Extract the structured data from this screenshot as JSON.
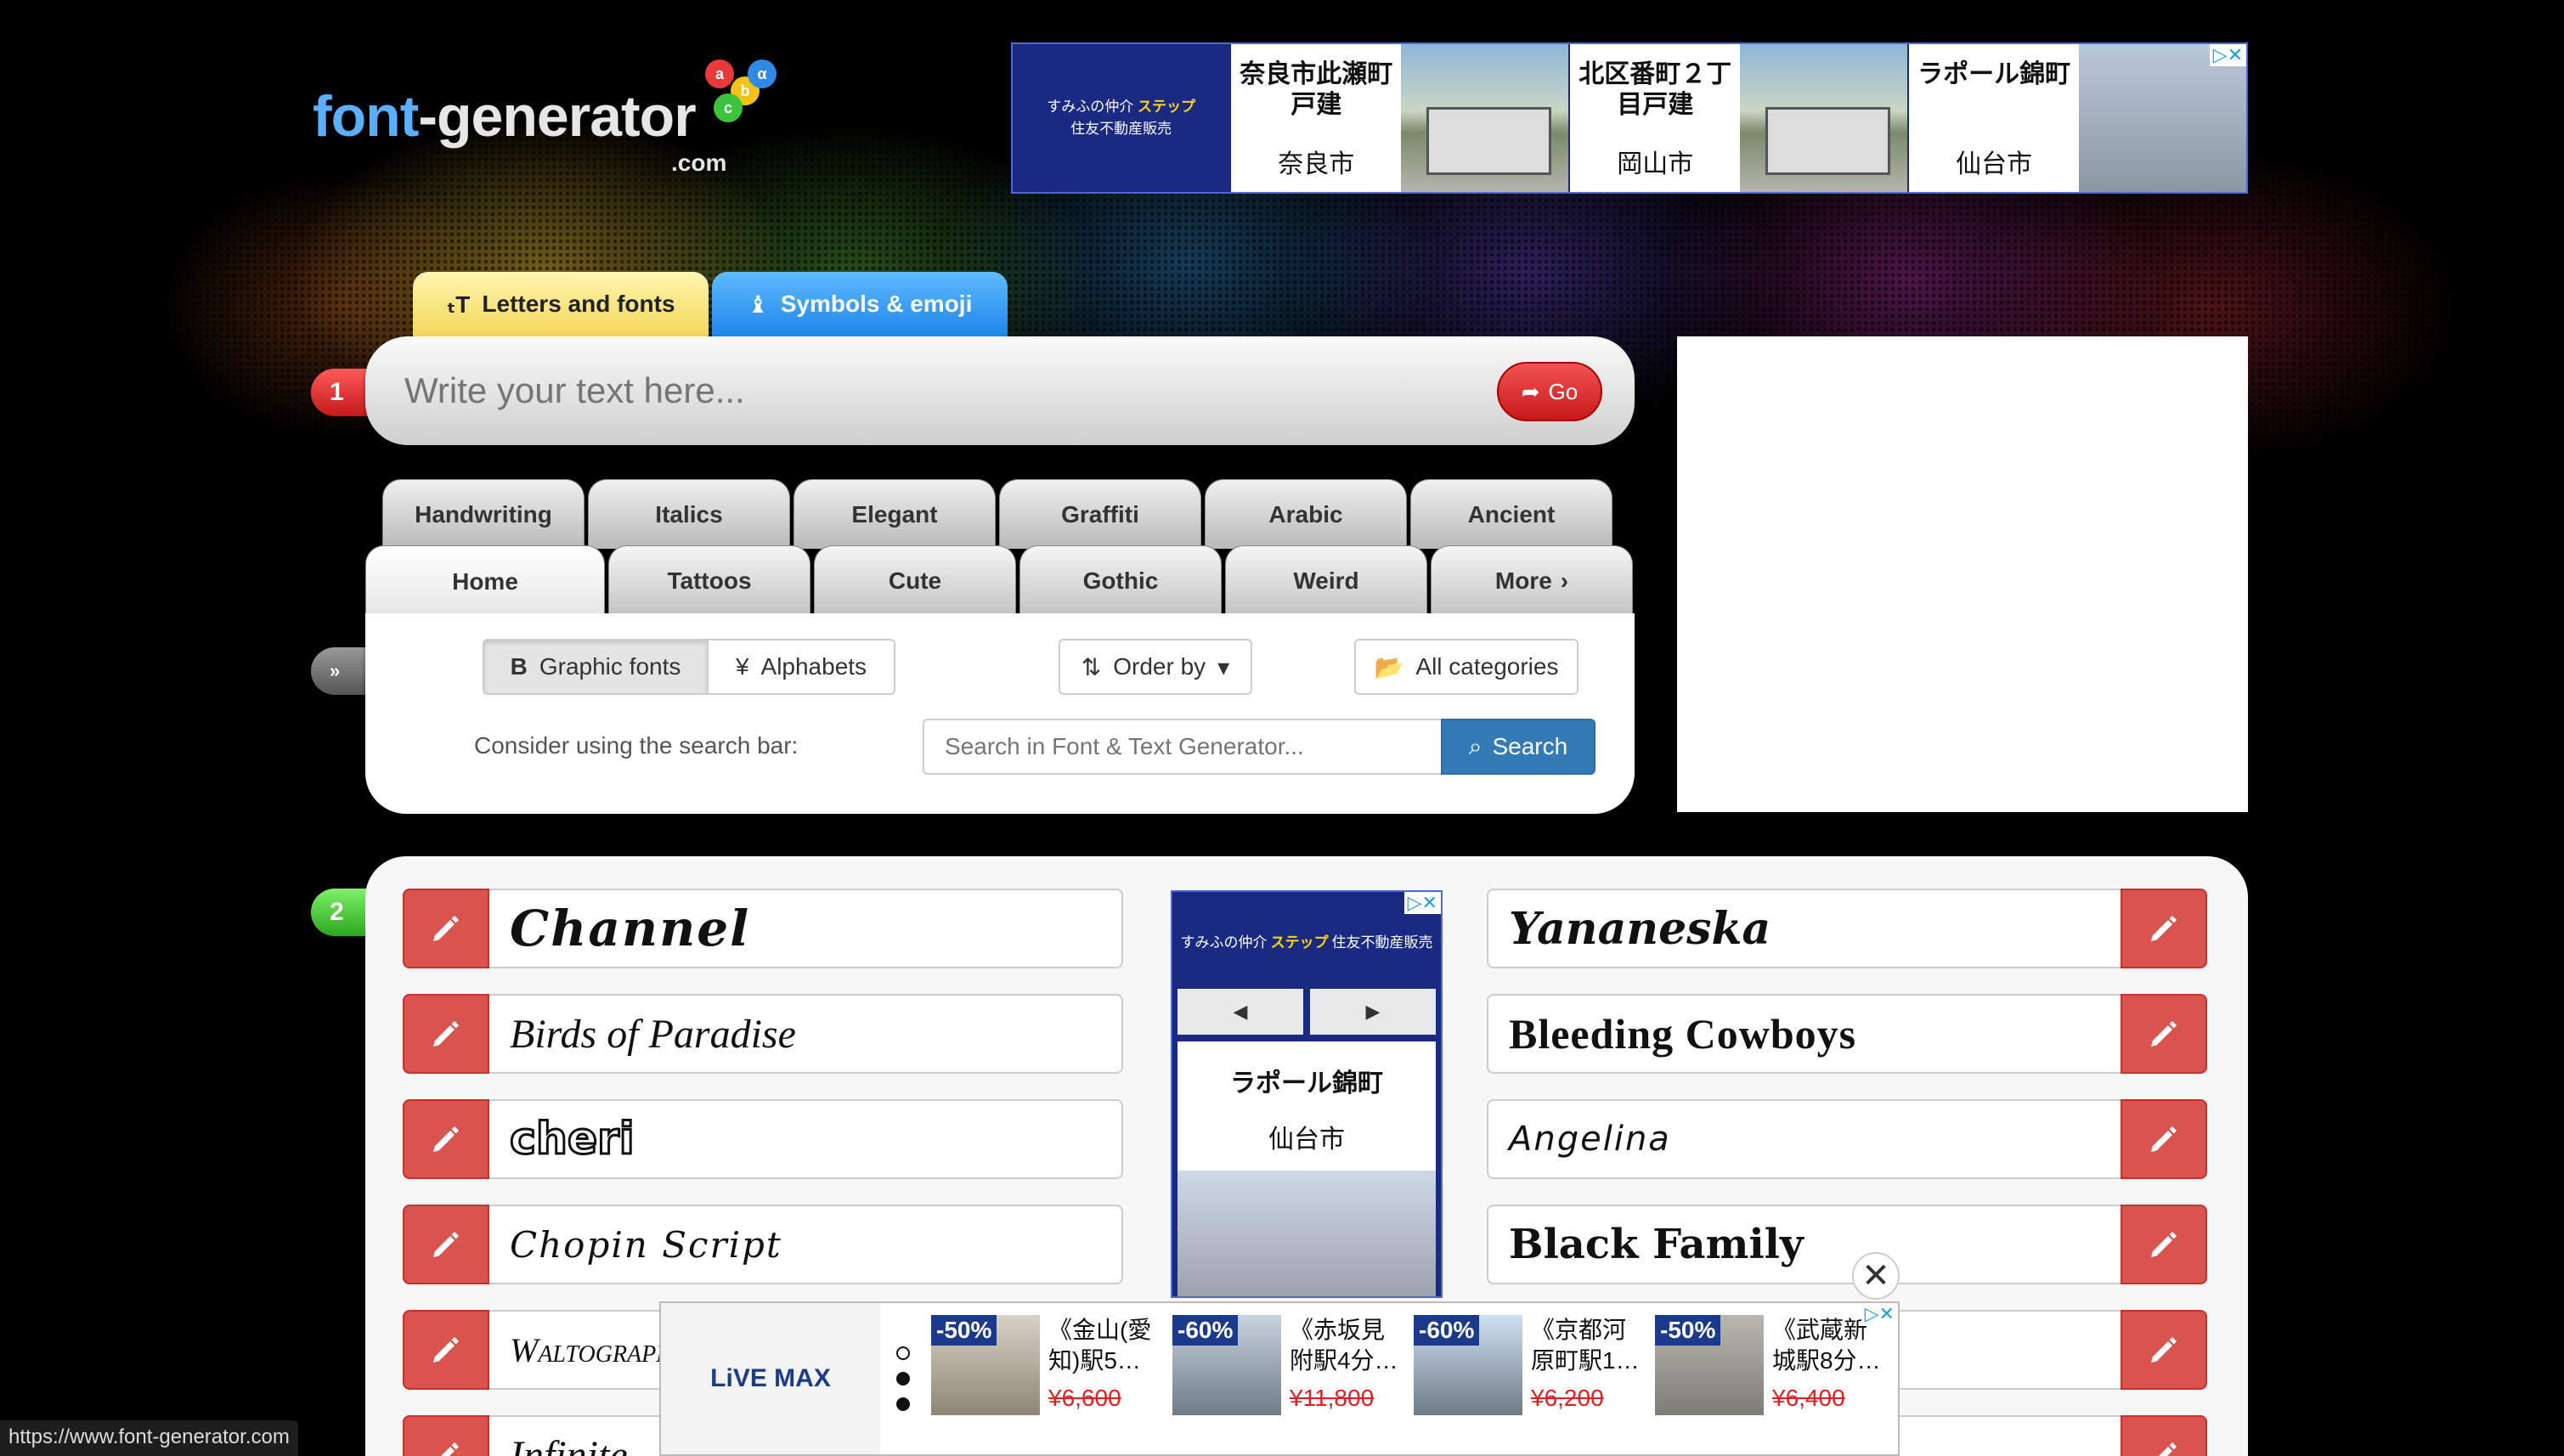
{
  "logo": {
    "font": "font",
    "rest": "-generator",
    "com": ".com",
    "balls": [
      "a",
      "b",
      "α",
      "c"
    ]
  },
  "top_ad": {
    "brand_line1": "すみふの仲介",
    "brand_line2": "ステップ",
    "brand_line3": "住友不動産販売",
    "cards": [
      {
        "title": "奈良市此瀬町\n戸建",
        "city": "奈良市"
      },
      {
        "title": "北区番町２丁\n目戸建",
        "city": "岡山市"
      },
      {
        "title": "ラポール錦町",
        "city": "仙台市"
      }
    ]
  },
  "tabs": {
    "letters": "Letters and fonts",
    "symbols": "Symbols & emoji"
  },
  "steps": {
    "one": "1",
    "two": "2",
    "more": "»"
  },
  "text_input": {
    "placeholder": "Write your text here...",
    "go": "Go"
  },
  "categories_row1": [
    "Handwriting",
    "Italics",
    "Elegant",
    "Graffiti",
    "Arabic",
    "Ancient"
  ],
  "categories_row2": [
    "Home",
    "Tattoos",
    "Cute",
    "Gothic",
    "Weird",
    "More"
  ],
  "filters": {
    "graphic": "Graphic fonts",
    "alphabets": "Alphabets",
    "order": "Order by",
    "categories": "All categories",
    "hint": "Consider using the search bar:",
    "search_placeholder": "Search in Font & Text Generator...",
    "search_btn": "Search"
  },
  "fonts_left": [
    "Channel",
    "Birds of Paradise",
    "cheri",
    "Chopin Script",
    "Waltograph",
    "Infinite"
  ],
  "fonts_right": [
    "Yananeska",
    "Bleeding Cowboys",
    "Angelina",
    "Black Family",
    "",
    ""
  ],
  "mid_ad": {
    "brand1": "すみふの仲介",
    "brand2": "ステップ",
    "brand3": "住友不動産販売",
    "prev": "◀",
    "next": "▶",
    "title": "ラポール錦町",
    "city": "仙台市"
  },
  "bottom_ad": {
    "brand": "LiVE MAX",
    "items": [
      {
        "pct": "-50%",
        "name": "《金山(愛知)駅5…",
        "price": "¥6,600"
      },
      {
        "pct": "-60%",
        "name": "《赤坂見附駅4分…",
        "price": "¥11,800"
      },
      {
        "pct": "-60%",
        "name": "《京都河原町駅1…",
        "price": "¥6,200"
      },
      {
        "pct": "-50%",
        "name": "《武蔵新城駅8分…",
        "price": "¥6,400"
      }
    ]
  },
  "status_url": "https://www.font-generator.com",
  "colors": {
    "accent_red": "#d9534f",
    "search_blue": "#337ab7",
    "ad_navy": "#1a2a82"
  }
}
